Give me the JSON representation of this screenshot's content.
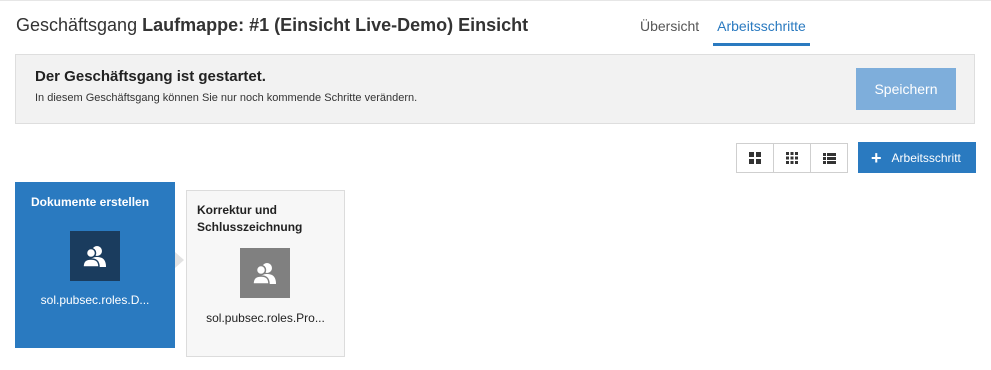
{
  "header": {
    "title_prefix": "Geschäftsgang",
    "title_main": "Laufmappe: #1 (Einsicht Live-Demo) Einsicht"
  },
  "tabs": [
    {
      "label": "Übersicht",
      "active": false
    },
    {
      "label": "Arbeitsschritte",
      "active": true
    }
  ],
  "notice": {
    "title": "Der Geschäftsgang ist gestartet.",
    "text": "In diesem Geschäftsgang können Sie nur noch kommende Schritte verändern.",
    "save_label": "Speichern"
  },
  "view_buttons": [
    "grid-large-icon",
    "grid-small-icon",
    "list-icon"
  ],
  "add_step": {
    "label": "Arbeitsschritt",
    "icon": "plus-icon"
  },
  "steps": [
    {
      "title": "Dokumente erstellen",
      "role": "sol.pubsec.roles.D...",
      "active": true
    },
    {
      "title": "Korrektur und Schlusszeichnung",
      "role": "sol.pubsec.roles.Pro...",
      "active": false
    }
  ],
  "colors": {
    "accent": "#2a7ac0",
    "save_disabled": "#7eaedb",
    "role_icon_active": "#1a3c5e",
    "role_icon_inactive": "#808080"
  }
}
